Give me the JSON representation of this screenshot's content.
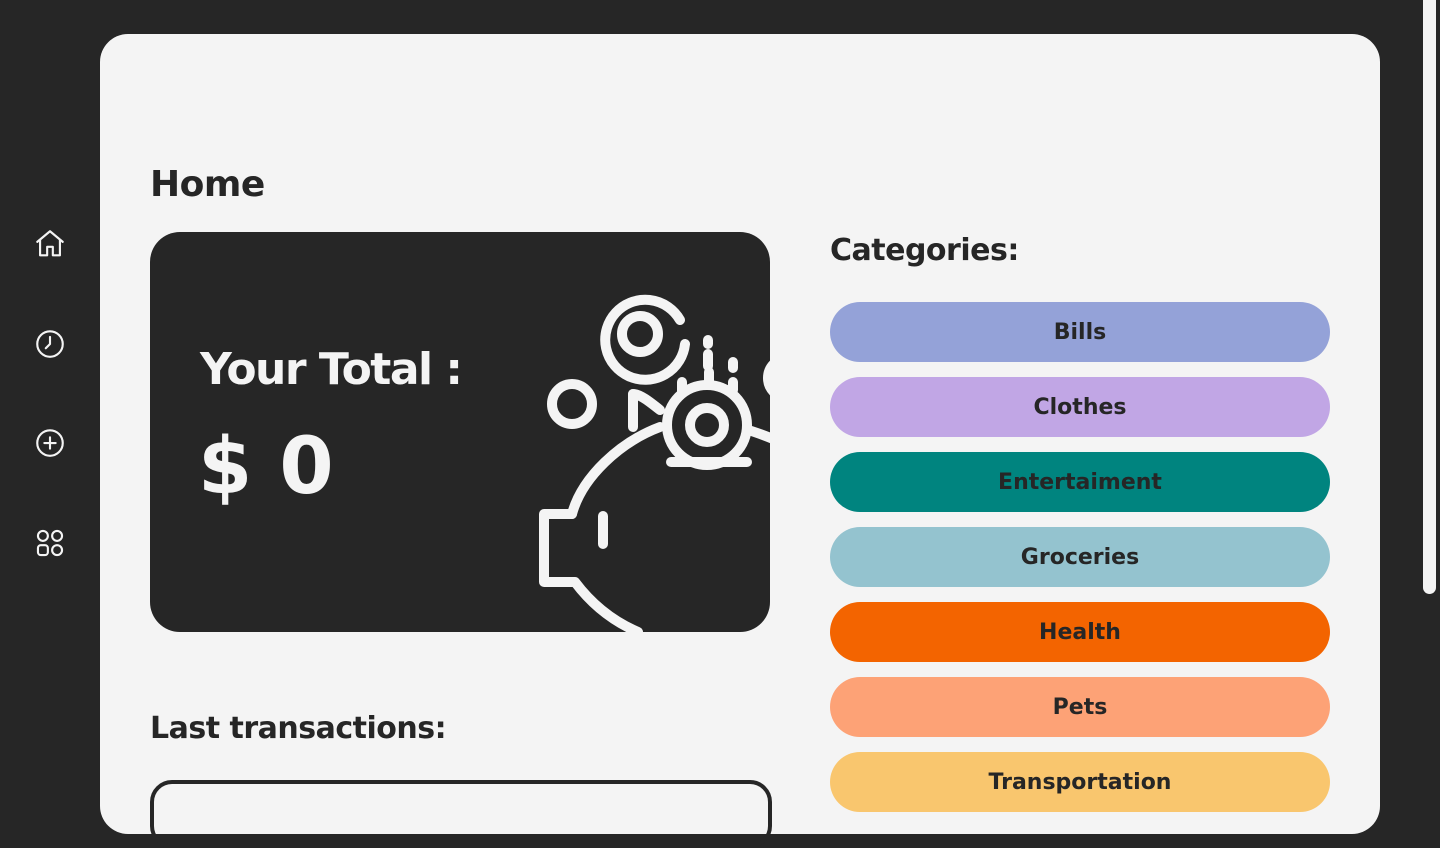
{
  "nav": {
    "items": [
      {
        "icon": "home-icon"
      },
      {
        "icon": "clock-icon"
      },
      {
        "icon": "plus-circle-icon"
      },
      {
        "icon": "grid-icon"
      }
    ]
  },
  "page": {
    "title": "Home"
  },
  "total_card": {
    "label": "Your Total :",
    "amount": "$ 0",
    "illustration": "piggy-bank-coins-icon"
  },
  "transactions": {
    "title": "Last transactions:"
  },
  "categories": {
    "title": "Categories:",
    "items": [
      {
        "label": "Bills",
        "color": "#94a2d8"
      },
      {
        "label": "Clothes",
        "color": "#c1a6e5"
      },
      {
        "label": "Entertaiment",
        "color": "#00847f"
      },
      {
        "label": "Groceries",
        "color": "#94c3cf"
      },
      {
        "label": "Health",
        "color": "#f36400"
      },
      {
        "label": "Pets",
        "color": "#fda276"
      },
      {
        "label": "Transportation",
        "color": "#f9c66e"
      }
    ]
  },
  "colors": {
    "background": "#262626",
    "panel": "#f4f4f4",
    "text": "#262626"
  }
}
